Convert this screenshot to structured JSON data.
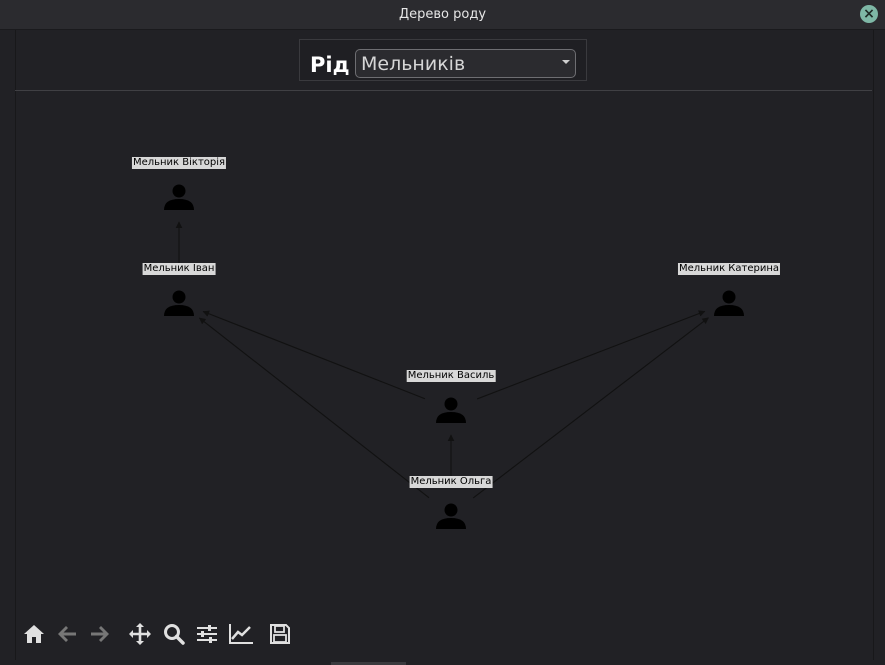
{
  "window": {
    "title": "Дерево роду"
  },
  "header": {
    "label": "Рід",
    "selected_family": "Мельників"
  },
  "graph": {
    "nodes": [
      {
        "id": "victoria",
        "label": "Мельник Вікторія"
      },
      {
        "id": "ivan",
        "label": "Мельник Іван"
      },
      {
        "id": "kateryna",
        "label": "Мельник Катерина"
      },
      {
        "id": "vasyl",
        "label": "Мельник Василь"
      },
      {
        "id": "olha",
        "label": "Мельник Ольга"
      }
    ],
    "edges": [
      {
        "from": "ivan",
        "to": "victoria"
      },
      {
        "from": "vasyl",
        "to": "ivan"
      },
      {
        "from": "vasyl",
        "to": "kateryna"
      },
      {
        "from": "olha",
        "to": "vasyl"
      },
      {
        "from": "olha",
        "to": "ivan"
      },
      {
        "from": "olha",
        "to": "kateryna"
      }
    ]
  },
  "toolbar": {
    "buttons": [
      {
        "name": "home-icon",
        "enabled": true
      },
      {
        "name": "back-arrow-icon",
        "enabled": false
      },
      {
        "name": "forward-arrow-icon",
        "enabled": false
      },
      {
        "name": "pan-icon",
        "enabled": true
      },
      {
        "name": "zoom-icon",
        "enabled": true
      },
      {
        "name": "configure-subplots-icon",
        "enabled": true
      },
      {
        "name": "edit-axis-icon",
        "enabled": true
      },
      {
        "name": "save-icon",
        "enabled": true
      }
    ]
  },
  "colors": {
    "background": "#212125",
    "node_icon": "#000000",
    "edge": "#111111",
    "label_bg": "#d8d8d8"
  }
}
